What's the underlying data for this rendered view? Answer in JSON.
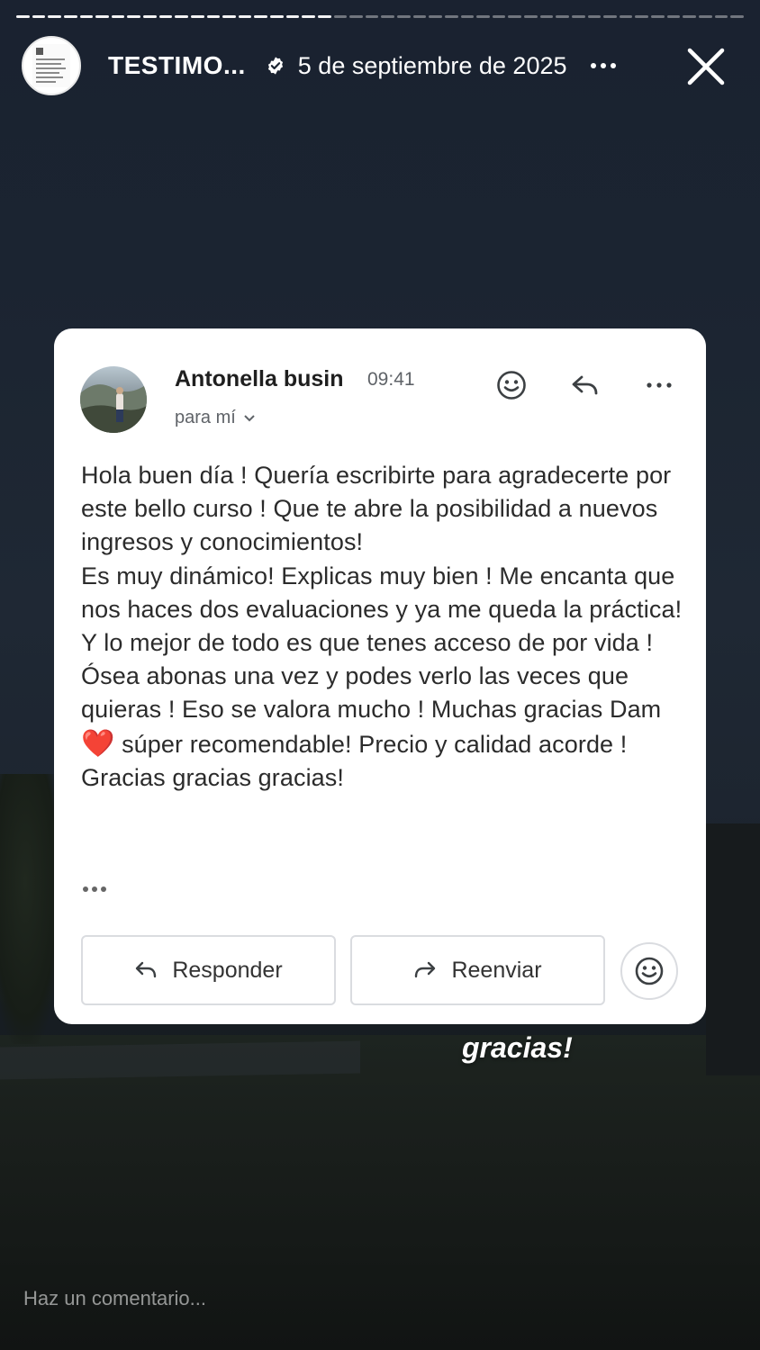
{
  "story": {
    "title": "TESTIMO...",
    "date": "5 de septiembre de 2025",
    "progress_segments": 46,
    "progress_done": 20
  },
  "email": {
    "sender_name": "Antonella busin",
    "time": "09:41",
    "recipient": "para mí",
    "body_paragraph_1": "Hola buen día ! Quería escribirte para agradecerte por este bello curso ! Que te abre la posibilidad a nuevos ingresos y conocimientos!",
    "body_paragraph_2a": "Es muy dinámico! Explicas muy bien ! Me encanta que nos haces dos evaluaciones y ya me queda la práctica! Y lo mejor de todo es que tenes acceso de por vida ! Ósea abonas una vez y podes verlo las veces que quieras ! Eso se valora mucho ! Muchas gracias Dam",
    "heart": "❤️",
    "body_paragraph_2b": " súper recomendable! Precio y calidad acorde ! Gracias gracias gracias!",
    "reply_label": "Responder",
    "forward_label": "Reenviar"
  },
  "sticker_text": "gracias!",
  "comment_placeholder": "Haz un comentario...",
  "colors": {
    "card_bg": "#ffffff",
    "heart": "#e0202a",
    "verified_badge": "#ffffff"
  }
}
